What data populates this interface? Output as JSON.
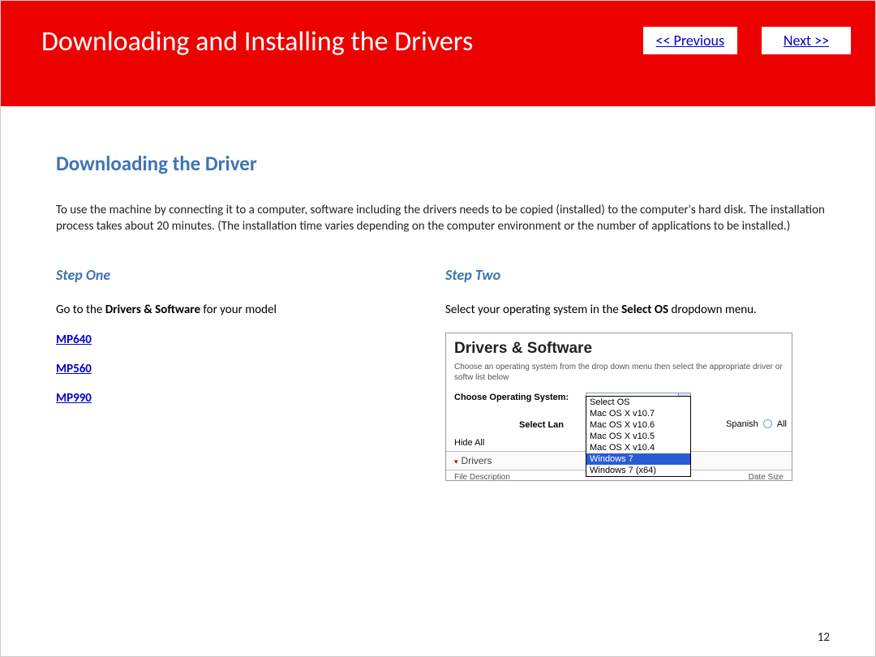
{
  "header": {
    "title": "Downloading and Installing  the Drivers",
    "prev": "<< Previous",
    "next": "Next >>"
  },
  "section_heading": "Downloading the Driver",
  "intro": "To use the machine by connecting it to a computer, software including the drivers needs to be copied (installed) to the computer's hard disk. The installation process takes about 20 minutes. (The installation time varies depending on the computer environment or the number of applications to be installed.)",
  "step1": {
    "heading": "Step One",
    "text_before": "Go to the ",
    "text_bold": "Drivers & Software",
    "text_after": " for your model",
    "models": [
      "MP640",
      "MP560",
      "MP990"
    ]
  },
  "step2": {
    "heading": "Step Two",
    "text_before": "Select your operating system in the ",
    "text_bold": "Select OS",
    "text_after": " dropdown menu."
  },
  "screenshot": {
    "title": "Drivers & Software",
    "sub": "Choose an operating system from the drop down menu then select the appropriate driver or softw list below",
    "choose_label": "Choose Operating System:",
    "selected": "Windows 7",
    "options": [
      "Select OS",
      "Mac OS X v10.7",
      "Mac OS X v10.6",
      "Mac OS X v10.5",
      "Mac OS X v10.4",
      "Windows 7",
      "Windows 7 (x64)"
    ],
    "lang_label": "Select Lan",
    "lang_spanish": "Spanish",
    "lang_all": "All",
    "hide": "Hide All",
    "section": "Drivers",
    "foot_left": "File Description",
    "foot_right": "Date   Size"
  },
  "page_number": "12"
}
